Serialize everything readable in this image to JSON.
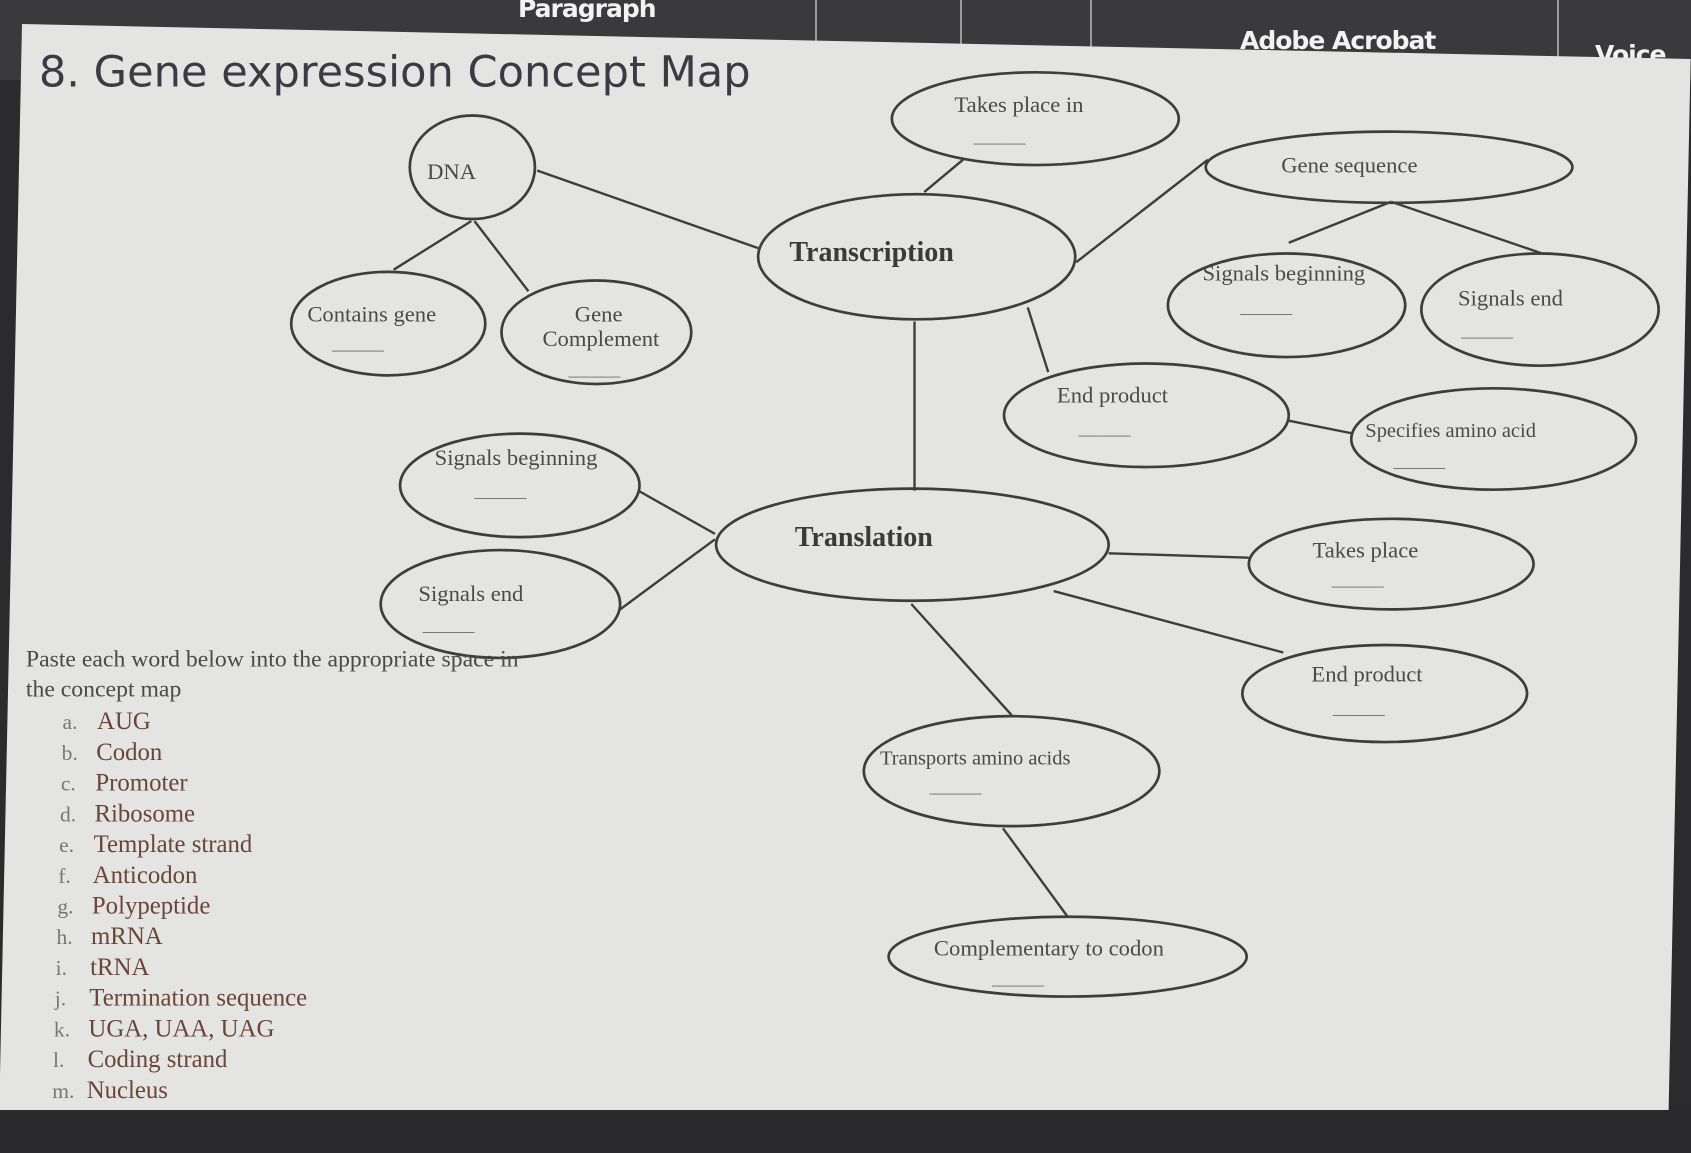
{
  "toolbar": {
    "paragraph": "Paragraph",
    "adobe_acrobat": "Adobe Acrobat",
    "voice": "Voice"
  },
  "title": "8. Gene expression Concept Map",
  "blank": "______",
  "nodes": {
    "dna": "DNA",
    "contains_gene": "Contains gene",
    "gene_complement_1": "Gene",
    "gene_complement_2": "Complement",
    "transcription": "Transcription",
    "takes_place_in": "Takes place in",
    "gene_sequence": "Gene sequence",
    "signals_beginning_top": "Signals beginning",
    "signals_end_top": "Signals end",
    "end_product_top": "End product",
    "specifies_amino_acid": "Specifies amino acid",
    "signals_beginning_left": "Signals beginning",
    "signals_end_left": "Signals end",
    "translation": "Translation",
    "takes_place": "Takes place",
    "end_product_bottom": "End product",
    "transports_amino_acids": "Transports amino acids",
    "complementary_to_codon": "Complementary to codon"
  },
  "instructions": {
    "line1": "Paste each word below into the appropriate space in",
    "line2": "the concept map"
  },
  "words": [
    {
      "letter": "a.",
      "word": "AUG"
    },
    {
      "letter": "b.",
      "word": "Codon"
    },
    {
      "letter": "c.",
      "word": "Promoter"
    },
    {
      "letter": "d.",
      "word": "Ribosome"
    },
    {
      "letter": "e.",
      "word": "Template strand"
    },
    {
      "letter": "f.",
      "word": "Anticodon"
    },
    {
      "letter": "g.",
      "word": "Polypeptide"
    },
    {
      "letter": "h.",
      "word": "mRNA"
    },
    {
      "letter": "i.",
      "word": "tRNA"
    },
    {
      "letter": "j.",
      "word": "Termination sequence"
    },
    {
      "letter": "k.",
      "word": "UGA, UAA, UAG"
    },
    {
      "letter": "l.",
      "word": "Coding strand"
    },
    {
      "letter": "m.",
      "word": "Nucleus"
    }
  ]
}
